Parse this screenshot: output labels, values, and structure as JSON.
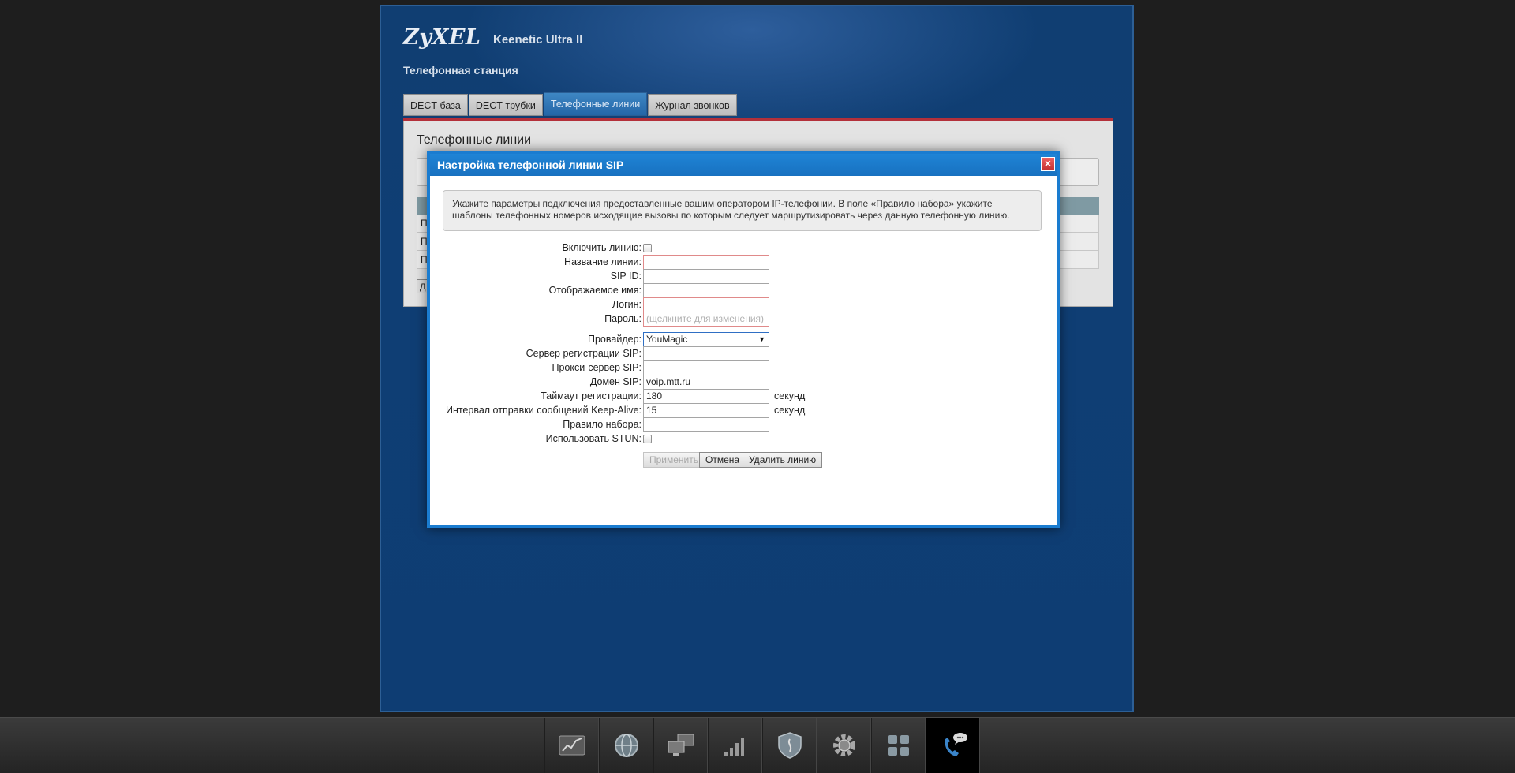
{
  "header": {
    "brand": "ZyXEL",
    "model": "Keenetic Ultra II",
    "section_title": "Телефонная станция"
  },
  "tabs": [
    {
      "label": "DECT-база",
      "active": false
    },
    {
      "label": "DECT-трубки",
      "active": false
    },
    {
      "label": "Телефонные линии",
      "active": true
    },
    {
      "label": "Журнал звонков",
      "active": false
    }
  ],
  "content": {
    "title": "Телефонные линии",
    "rows": [
      "П",
      "П",
      "П"
    ],
    "add_button": "Д"
  },
  "dialog": {
    "title": "Настройка телефонной линии SIP",
    "info": "Укажите параметры подключения предоставленные вашим оператором IP-телефонии. В поле «Правило набора» укажите шаблоны телефонных номеров исходящие вызовы по которым следует маршрутизировать через данную телефонную линию.",
    "fields": {
      "enable_line": {
        "label": "Включить линию:",
        "checked": false
      },
      "line_name": {
        "label": "Название линии:",
        "value": ""
      },
      "sip_id": {
        "label": "SIP ID:",
        "value": ""
      },
      "display_name": {
        "label": "Отображаемое имя:",
        "value": ""
      },
      "login": {
        "label": "Логин:",
        "value": ""
      },
      "password": {
        "label": "Пароль:",
        "placeholder": "(щелкните для изменения)"
      },
      "provider": {
        "label": "Провайдер:",
        "value": "YouMagic"
      },
      "reg_server": {
        "label": "Сервер регистрации SIP:",
        "value": ""
      },
      "proxy_server": {
        "label": "Прокси-сервер SIP:",
        "value": ""
      },
      "sip_domain": {
        "label": "Домен SIP:",
        "value": "voip.mtt.ru"
      },
      "reg_timeout": {
        "label": "Таймаут регистрации:",
        "value": "180",
        "unit": "секунд"
      },
      "keepalive": {
        "label": "Интервал отправки сообщений Keep-Alive:",
        "value": "15",
        "unit": "секунд"
      },
      "dial_rule": {
        "label": "Правило набора:",
        "value": ""
      },
      "use_stun": {
        "label": "Использовать STUN:",
        "checked": false
      }
    },
    "buttons": {
      "apply": "Применить",
      "cancel": "Отмена",
      "delete": "Удалить линию"
    }
  },
  "taskbar": {
    "items": [
      {
        "icon": "chart-icon",
        "active": false
      },
      {
        "icon": "globe-icon",
        "active": false
      },
      {
        "icon": "network-computers-icon",
        "active": false
      },
      {
        "icon": "signal-bars-icon",
        "active": false
      },
      {
        "icon": "shield-icon",
        "active": false
      },
      {
        "icon": "gear-icon",
        "active": false
      },
      {
        "icon": "apps-grid-icon",
        "active": false
      },
      {
        "icon": "phone-chat-icon",
        "active": true
      }
    ]
  },
  "colors": {
    "accent": "#1a7cd0",
    "panel_bg": "#0f3e74",
    "required_border": "#e08a8a",
    "tab_active": "#2466a8"
  }
}
